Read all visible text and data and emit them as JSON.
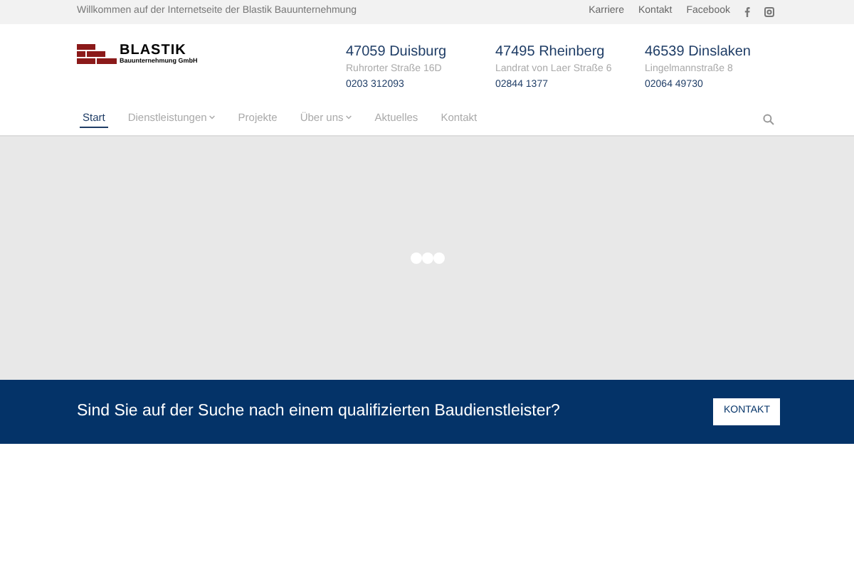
{
  "top_bar": {
    "welcome": "Willkommen auf der Internetseite der Blastik Bauunternehmung",
    "links": [
      "Karriere",
      "Kontakt",
      "Facebook"
    ]
  },
  "logo": {
    "name": "BLASTIK",
    "subtitle": "Bauunternehmung GmbH"
  },
  "locations": [
    {
      "city": "47059 Duisburg",
      "street": "Ruhrorter Straße 16D",
      "phone": "0203 312093"
    },
    {
      "city": "47495 Rheinberg",
      "street": "Landrat von Laer Straße 6",
      "phone": "02844 1377"
    },
    {
      "city": "46539 Dinslaken",
      "street": "Lingelmannstraße 8",
      "phone": "02064 49730"
    }
  ],
  "nav": [
    {
      "label": "Start",
      "selected": true,
      "dropdown": false
    },
    {
      "label": "Dienstleistungen",
      "selected": false,
      "dropdown": true
    },
    {
      "label": "Projekte",
      "selected": false,
      "dropdown": false
    },
    {
      "label": "Über uns",
      "selected": false,
      "dropdown": true
    },
    {
      "label": "Aktuelles",
      "selected": false,
      "dropdown": false
    },
    {
      "label": "Kontakt",
      "selected": false,
      "dropdown": false
    }
  ],
  "banner": {
    "text": "Sind Sie auf der Suche nach einem qualifizierten Baudienstleister?",
    "button": "KONTAKT"
  }
}
